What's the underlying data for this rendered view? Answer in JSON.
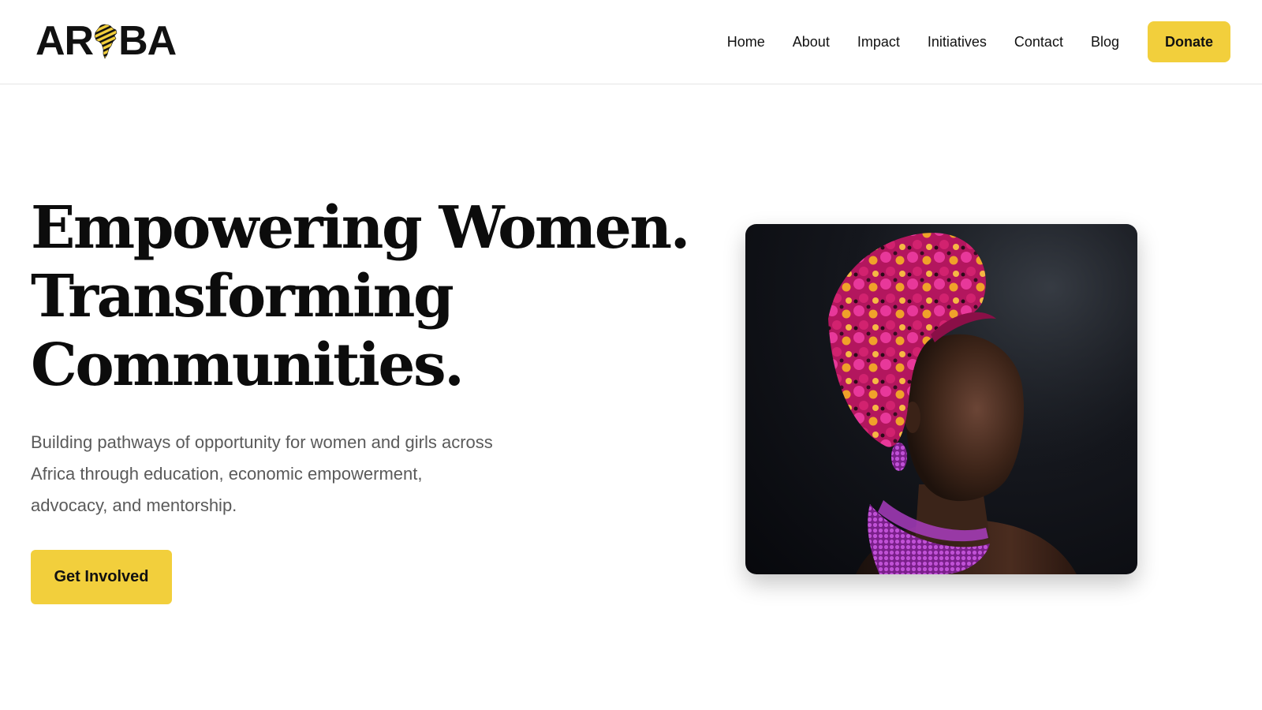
{
  "brand": {
    "logo_left": "AR",
    "logo_right": "BA",
    "logo_mark_icon": "africa-map-icon",
    "accent_color": "#f2cf3c"
  },
  "nav": {
    "items": [
      {
        "label": "Home"
      },
      {
        "label": "About"
      },
      {
        "label": "Impact"
      },
      {
        "label": "Initiatives"
      },
      {
        "label": "Contact"
      },
      {
        "label": "Blog"
      }
    ],
    "donate_label": "Donate"
  },
  "hero": {
    "title_lines": [
      "Empowering Women.",
      "Transforming",
      "Communities."
    ],
    "subtitle": "Building pathways of opportunity for women and girls across Africa through education, economic empowerment, advocacy, and mentorship.",
    "cta_label": "Get Involved"
  }
}
